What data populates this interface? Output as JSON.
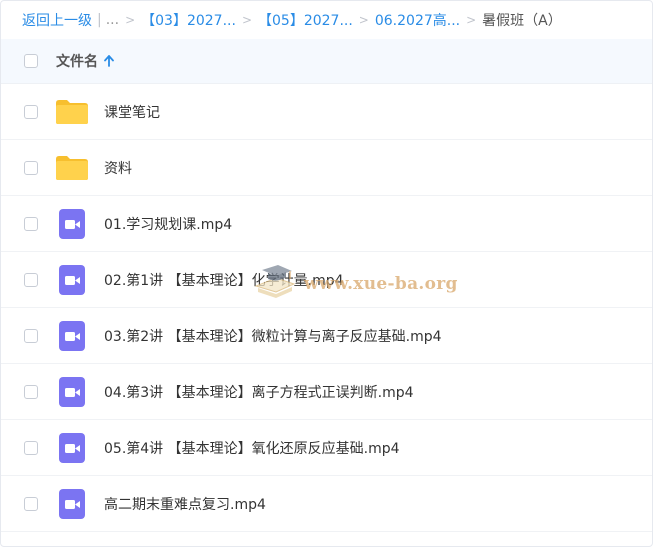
{
  "breadcrumb": {
    "back_label": "返回上一级",
    "ellipsis": "...",
    "crumbs": [
      "【03】2027...",
      "【05】2027...",
      "06.2027高..."
    ],
    "current": "暑假班（A）"
  },
  "table": {
    "header_label": "文件名",
    "sort_icon": "arrow-up-icon",
    "rows": [
      {
        "name": "课堂笔记",
        "icon": "folder-icon"
      },
      {
        "name": "资料",
        "icon": "folder-icon"
      },
      {
        "name": "01.学习规划课.mp4",
        "icon": "video-icon"
      },
      {
        "name": "02.第1讲 【基本理论】化学计量.mp4",
        "icon": "video-icon"
      },
      {
        "name": "03.第2讲 【基本理论】微粒计算与离子反应基础.mp4",
        "icon": "video-icon"
      },
      {
        "name": "04.第3讲 【基本理论】离子方程式正误判断.mp4",
        "icon": "video-icon"
      },
      {
        "name": "05.第4讲 【基本理论】氧化还原反应基础.mp4",
        "icon": "video-icon"
      },
      {
        "name": "高二期末重难点复习.mp4",
        "icon": "video-icon"
      }
    ]
  },
  "watermark": {
    "text": "www.xue-ba.org",
    "icon": "graduation-cap-logo"
  },
  "colors": {
    "link": "#2a8ce6",
    "folder": "#ffcf4b",
    "video": "#7b74f2",
    "header_bg": "#f5f9fe"
  }
}
